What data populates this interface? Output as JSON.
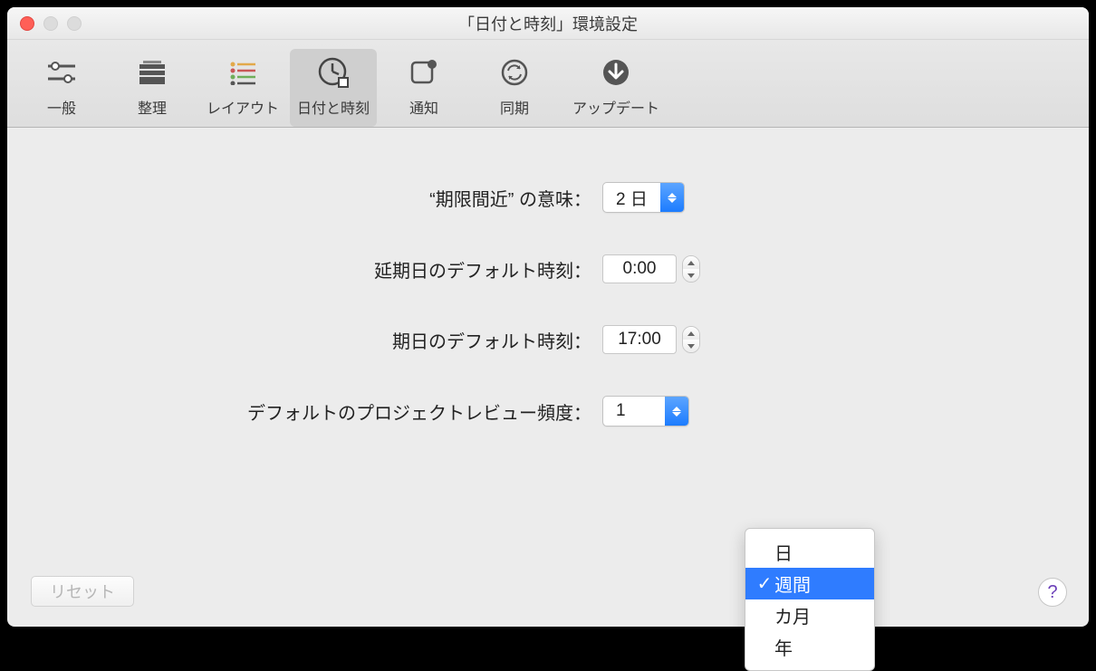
{
  "window": {
    "title": "「日付と時刻」環境設定"
  },
  "toolbar": {
    "items": [
      {
        "label": "一般"
      },
      {
        "label": "整理"
      },
      {
        "label": "レイアウト"
      },
      {
        "label": "日付と時刻"
      },
      {
        "label": "通知"
      },
      {
        "label": "同期"
      },
      {
        "label": "アップデート"
      }
    ],
    "selected_index": 3
  },
  "form": {
    "due_soon_label": "“期限間近” の意味：",
    "due_soon_value": "2 日",
    "defer_time_label": "延期日のデフォルト時刻：",
    "defer_time_value": "0:00",
    "due_time_label": "期日のデフォルト時刻：",
    "due_time_value": "17:00",
    "review_label": "デフォルトのプロジェクトレビュー頻度：",
    "review_number": "1",
    "review_unit_options": [
      "日",
      "週間",
      "カ月",
      "年"
    ],
    "review_unit_selected_index": 1
  },
  "footer": {
    "reset_label": "リセット",
    "help_label": "?"
  },
  "colors": {
    "accent": "#2f7cff"
  }
}
